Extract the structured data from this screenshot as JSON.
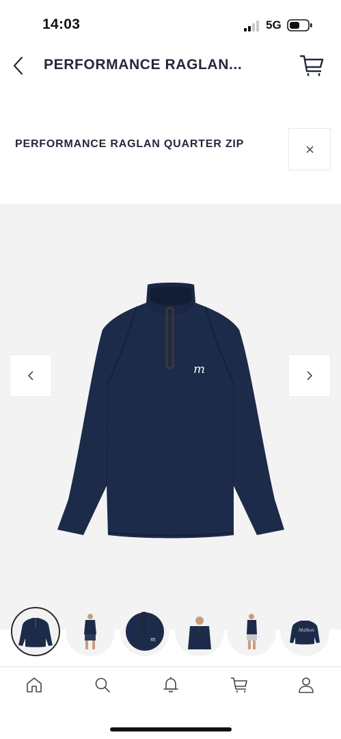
{
  "status_bar": {
    "time": "14:03",
    "network": "5G"
  },
  "nav": {
    "title": "PERFORMANCE RAGLAN...",
    "back_icon": "chevron-left-icon",
    "cart_icon": "cart-icon"
  },
  "product": {
    "name": "PERFORMANCE RAGLAN QUARTER ZIP",
    "close_icon": "close-icon",
    "color": "#1d2b4a",
    "logo_text": "m"
  },
  "gallery": {
    "prev_icon": "chevron-left-icon",
    "next_icon": "chevron-right-icon",
    "thumbnails": [
      "flat-front",
      "model-front",
      "collar-detail",
      "model-close",
      "model-side",
      "flat-back"
    ],
    "active_thumbnail": 0
  },
  "tabs": [
    "home-icon",
    "search-icon",
    "bell-icon",
    "cart-icon",
    "account-icon"
  ]
}
